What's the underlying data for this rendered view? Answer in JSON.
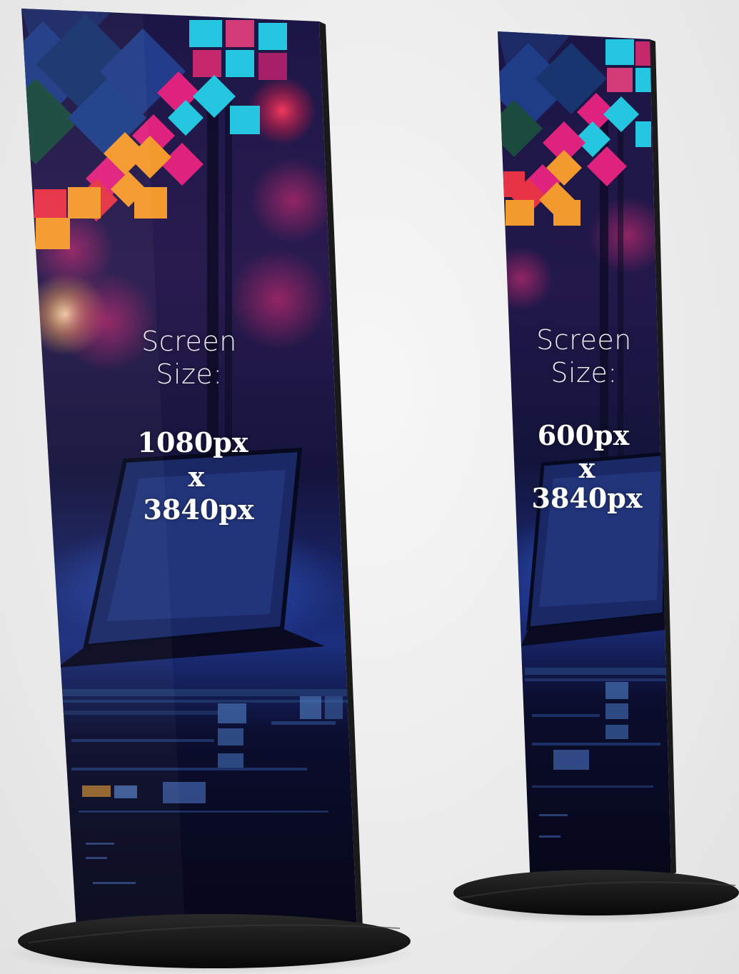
{
  "displays": [
    {
      "screen_label_line1": "Screen",
      "screen_label_line2": "Size:",
      "width_text": "1080px",
      "times_text": "x",
      "height_text": "3840px"
    },
    {
      "screen_label_line1": "Screen",
      "screen_label_line2": "Size:",
      "width_text": "600px",
      "times_text": "x",
      "height_text": "3840px"
    }
  ],
  "colors": {
    "background": "#ececec",
    "screen_dark": "#0b0a2a",
    "screen_blue": "#1a2f7a",
    "accent_cyan": "#25c6e0",
    "accent_magenta": "#e0227f",
    "accent_orange": "#f39a2e",
    "accent_red": "#e63346",
    "accent_navy": "#1c2a66",
    "base_black": "#141414"
  }
}
